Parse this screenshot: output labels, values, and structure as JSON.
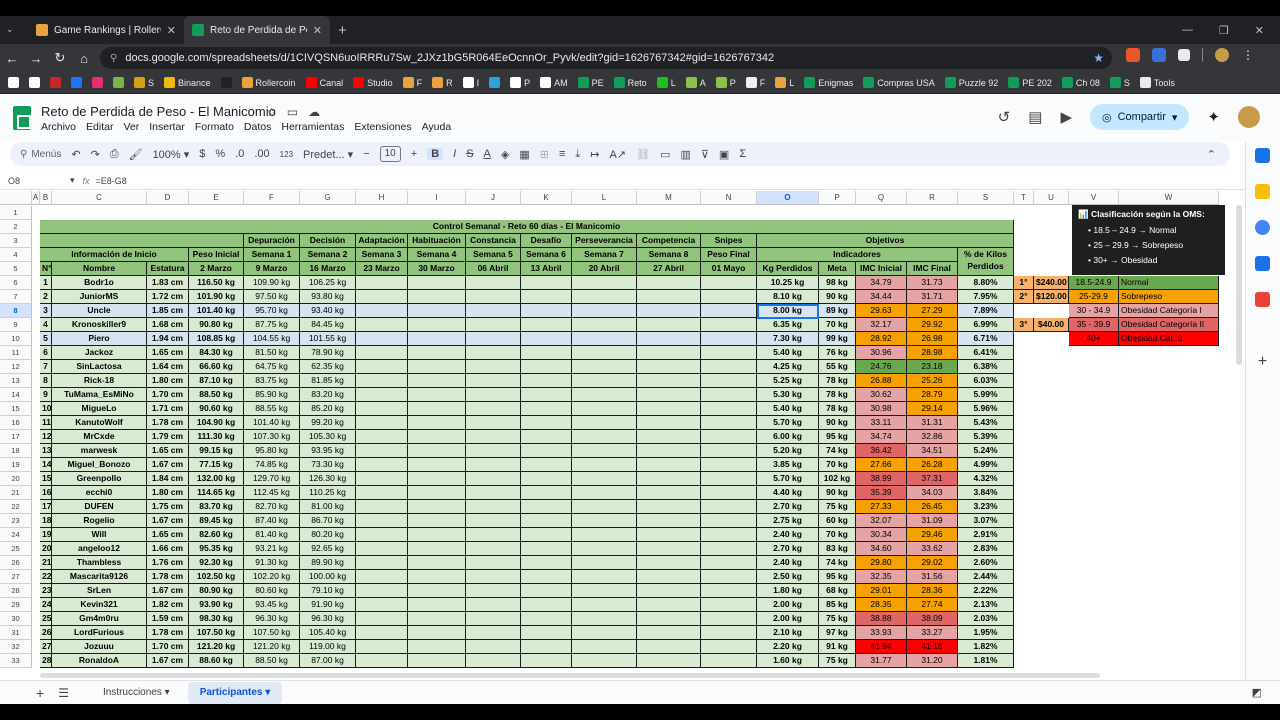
{
  "browser": {
    "tabs": [
      {
        "title": "Game Rankings | RollerCoin.com",
        "close": "✕",
        "favicon_color": "#e8a33d"
      },
      {
        "title": "Reto de Perdida de Peso - El Manicomio",
        "close": "✕",
        "favicon_color": "#0f9d58"
      }
    ],
    "new_tab": "+",
    "url": "docs.google.com/spreadsheets/d/1CIVQSN6uoIRRRu7Sw_2JXz1bG5R064EeOcnnOr_Pyvk/edit?gid=1626767342#gid=1626767342",
    "bookmarks": [
      "",
      "",
      "",
      "",
      "",
      "",
      "S",
      "Binance",
      "",
      "Rollercoin",
      "Canal",
      "Studio",
      "F",
      "R",
      "I",
      "",
      "P",
      "AM",
      "PE",
      "Reto",
      "L",
      "A",
      "P",
      "F",
      "L",
      "Enigmas",
      "Compras USA",
      "Puzzle 92",
      "PE 202",
      "Ch 08",
      "S",
      "Tools"
    ],
    "bookmark_colors": [
      "#ffffff",
      "#ffffff",
      "#c62828",
      "#1877f2",
      "#e1306c",
      "#7cb342",
      "#d4a017",
      "#f0b90b",
      "#222",
      "#e8a33d",
      "#ff0000",
      "#ff0000",
      "#e8a33d",
      "#e8a33d",
      "#ffffff",
      "#2aa3e0",
      "#ffffff",
      "#ffffff",
      "#0f9d58",
      "#0f9d58",
      "#1dbf1d",
      "#8bc34a",
      "#8bc34a",
      "#eeeeee",
      "#e8a33d",
      "#0f9d58",
      "#0f9d58",
      "#0f9d58",
      "#0f9d58",
      "#0f9d58",
      "#0f9d58",
      "#e8eaed"
    ]
  },
  "doc": {
    "title": "Reto de Perdida de Peso - El Manicomio",
    "menus": [
      "Archivo",
      "Editar",
      "Ver",
      "Insertar",
      "Formato",
      "Datos",
      "Herramientas",
      "Extensiones",
      "Ayuda"
    ],
    "share_label": "Compartir"
  },
  "toolbar": {
    "search_label": "Menús",
    "zoom": "100%",
    "currency": "$",
    "percent": "%",
    "dec_decrease": ".0",
    "dec_increase": ".00",
    "number_format": "123",
    "font": "Predet...",
    "font_size": "10",
    "minus": "−",
    "plus": "+"
  },
  "formula_bar": {
    "cell_ref": "O8",
    "fx": "fx",
    "formula": "=E8-G8"
  },
  "columns": [
    "A",
    "B",
    "C",
    "D",
    "E",
    "F",
    "G",
    "H",
    "I",
    "J",
    "K",
    "L",
    "M",
    "N",
    "O",
    "P",
    "Q",
    "R",
    "S",
    "T",
    "U",
    "V",
    "W"
  ],
  "selected_column": "O",
  "selected_row": "8",
  "sheet": {
    "banner": "Control Semanal - Reto 60 días - El Manicomio",
    "group_info": "Información de Inicio",
    "group_objetivos": "Objetivos",
    "group_indicadores": "Indicadores",
    "pct_header": "% de Kilos Perdidos",
    "week_titles": [
      "Peso Inicial",
      "Depuración",
      "Decisión",
      "Adaptación",
      "Habituación",
      "Constancia",
      "Desafío",
      "Perseverancia",
      "Competencia",
      "Snipes"
    ],
    "week_labels": [
      "Semana 1",
      "Semana 2",
      "Semana 3",
      "Semana 4",
      "Semana 5",
      "Semana 6",
      "Semana 7",
      "Semana 8",
      "Peso Final"
    ],
    "subheaders": [
      "N°",
      "Nombre",
      "Estatura",
      "2 Marzo",
      "9 Marzo",
      "16 Marzo",
      "23 Marzo",
      "30 Marzo",
      "06 Abril",
      "13 Abril",
      "20 Abril",
      "27 Abril",
      "01 Mayo",
      "Kg Perdidos",
      "Meta",
      "IMC Inicial",
      "IMC Final"
    ],
    "rows": [
      [
        "1",
        "Bodr1o",
        "1.83 cm",
        "116.50 kg",
        "109.90 kg",
        "106.25 kg",
        "10.25 kg",
        "98 kg",
        "34.79",
        "31.73",
        "8.80%"
      ],
      [
        "2",
        "JuniorMS",
        "1.72 cm",
        "101.90 kg",
        "97.50 kg",
        "93.80 kg",
        "8.10 kg",
        "90 kg",
        "34.44",
        "31.71",
        "7.95%"
      ],
      [
        "3",
        "Uncle",
        "1.85 cm",
        "101.40 kg",
        "95.70 kg",
        "93.40 kg",
        "8.00 kg",
        "89 kg",
        "29.63",
        "27.29",
        "7.89%"
      ],
      [
        "4",
        "Kronoskiller9",
        "1.68 cm",
        "90.80 kg",
        "87.75 kg",
        "84.45 kg",
        "6.35 kg",
        "70 kg",
        "32.17",
        "29.92",
        "6.99%"
      ],
      [
        "5",
        "Piero",
        "1.94 cm",
        "108.85 kg",
        "104.55 kg",
        "101.55 kg",
        "7.30 kg",
        "99 kg",
        "28.92",
        "26.98",
        "6.71%"
      ],
      [
        "6",
        "Jackoz",
        "1.65 cm",
        "84.30 kg",
        "81.50 kg",
        "78.90 kg",
        "5.40 kg",
        "76 kg",
        "30.96",
        "28.98",
        "6.41%"
      ],
      [
        "7",
        "SinLactosa",
        "1.64 cm",
        "66.60 kg",
        "64.75 kg",
        "62.35 kg",
        "4.25 kg",
        "55 kg",
        "24.76",
        "23.18",
        "6.38%"
      ],
      [
        "8",
        "Rick-18",
        "1.80 cm",
        "87.10 kg",
        "83.75 kg",
        "81.85 kg",
        "5.25 kg",
        "78 kg",
        "26.88",
        "25.26",
        "6.03%"
      ],
      [
        "9",
        "TuMama_EsMiNo",
        "1.70 cm",
        "88.50 kg",
        "85.90 kg",
        "83.20 kg",
        "5.30 kg",
        "78 kg",
        "30.62",
        "28.79",
        "5.99%"
      ],
      [
        "10",
        "MigueLo",
        "1.71 cm",
        "90.60 kg",
        "88.55 kg",
        "85.20 kg",
        "5.40 kg",
        "78 kg",
        "30.98",
        "29.14",
        "5.96%"
      ],
      [
        "11",
        "KanutoWolf",
        "1.78 cm",
        "104.90 kg",
        "101.40 kg",
        "99.20 kg",
        "5.70 kg",
        "90 kg",
        "33.11",
        "31.31",
        "5.43%"
      ],
      [
        "12",
        "MrCxde",
        "1.79 cm",
        "111.30 kg",
        "107.30 kg",
        "105.30 kg",
        "6.00 kg",
        "95 kg",
        "34.74",
        "32.86",
        "5.39%"
      ],
      [
        "13",
        "marwesk",
        "1.65 cm",
        "99.15 kg",
        "95.80 kg",
        "93.95 kg",
        "5.20 kg",
        "74 kg",
        "36.42",
        "34.51",
        "5.24%"
      ],
      [
        "14",
        "Miguel_Bonozo",
        "1.67 cm",
        "77.15 kg",
        "74.85 kg",
        "73.30 kg",
        "3.85 kg",
        "70 kg",
        "27.66",
        "26.28",
        "4.99%"
      ],
      [
        "15",
        "Greenpollo",
        "1.84 cm",
        "132.00 kg",
        "129.70 kg",
        "126.30 kg",
        "5.70 kg",
        "102 kg",
        "38.99",
        "37.31",
        "4.32%"
      ],
      [
        "16",
        "ecchi0",
        "1.80 cm",
        "114.65 kg",
        "112.45 kg",
        "110.25 kg",
        "4.40 kg",
        "90 kg",
        "35.39",
        "34.03",
        "3.84%"
      ],
      [
        "17",
        "DUFEN",
        "1.75 cm",
        "83.70 kg",
        "82.70 kg",
        "81.00 kg",
        "2.70 kg",
        "75 kg",
        "27.33",
        "26.45",
        "3.23%"
      ],
      [
        "18",
        "Rogelio",
        "1.67 cm",
        "89.45 kg",
        "87.40 kg",
        "86.70 kg",
        "2.75 kg",
        "60 kg",
        "32.07",
        "31.09",
        "3.07%"
      ],
      [
        "19",
        "Will",
        "1.65 cm",
        "82.60 kg",
        "81.40 kg",
        "80.20 kg",
        "2.40 kg",
        "70 kg",
        "30.34",
        "29.46",
        "2.91%"
      ],
      [
        "20",
        "angeloo12",
        "1.66 cm",
        "95.35 kg",
        "93.21 kg",
        "92.65 kg",
        "2.70 kg",
        "83 kg",
        "34.60",
        "33.62",
        "2.83%"
      ],
      [
        "21",
        "Thambless",
        "1.76 cm",
        "92.30 kg",
        "91.30 kg",
        "89.90 kg",
        "2.40 kg",
        "74 kg",
        "29.80",
        "29.02",
        "2.60%"
      ],
      [
        "22",
        "Mascarita9126",
        "1.78 cm",
        "102.50 kg",
        "102.20 kg",
        "100.00 kg",
        "2.50 kg",
        "95 kg",
        "32.35",
        "31.56",
        "2.44%"
      ],
      [
        "23",
        "SrLen",
        "1.67 cm",
        "80.90 kg",
        "80.60 kg",
        "79.10 kg",
        "1.80 kg",
        "68 kg",
        "29.01",
        "28.36",
        "2.22%"
      ],
      [
        "24",
        "Kevin321",
        "1.82 cm",
        "93.90 kg",
        "93.45 kg",
        "91.90 kg",
        "2.00 kg",
        "85 kg",
        "28.35",
        "27.74",
        "2.13%"
      ],
      [
        "25",
        "Gm4m0ru",
        "1.59 cm",
        "98.30 kg",
        "96.30 kg",
        "96.30 kg",
        "2.00 kg",
        "75 kg",
        "38.88",
        "38.09",
        "2.03%"
      ],
      [
        "26",
        "LordFurious",
        "1.78 cm",
        "107.50 kg",
        "107.50 kg",
        "105.40 kg",
        "2.10 kg",
        "97 kg",
        "33.93",
        "33.27",
        "1.95%"
      ],
      [
        "27",
        "Jozuuu",
        "1.70 cm",
        "121.20 kg",
        "121.20 kg",
        "119.00 kg",
        "2.20 kg",
        "91 kg",
        "41.94",
        "41.18",
        "1.82%"
      ],
      [
        "28",
        "RonaldoA",
        "1.67 cm",
        "88.60 kg",
        "88.50 kg",
        "87.00 kg",
        "1.60 kg",
        "75 kg",
        "31.77",
        "31.20",
        "1.81%"
      ]
    ],
    "prizes": [
      {
        "place": "1°",
        "amount": "$240.00"
      },
      {
        "place": "2°",
        "amount": "$120.00"
      },
      {
        "place": "3°",
        "amount": "$40.00"
      }
    ],
    "bmi_categories": [
      {
        "range": "18.5-24.9",
        "label": "Normal",
        "color": "#6aa84f"
      },
      {
        "range": "25-29.9",
        "label": "Sobrepeso",
        "color": "#f6a100"
      },
      {
        "range": "30 - 34.9",
        "label": "Obesidad Categoría I",
        "color": "#e6a3a3"
      },
      {
        "range": "35 - 39.9",
        "label": "Obesidad Categoría II",
        "color": "#e06666"
      },
      {
        "range": "40+",
        "label": "Obesidad Cat. 3",
        "color": "#ff0000"
      }
    ]
  },
  "legend": {
    "title": "📊 Clasificación según la OMS:",
    "items": [
      "• 18.5 – 24.9 → Normal",
      "• 25 – 29.9 → Sobrepeso",
      "• 30+ → Obesidad"
    ]
  },
  "sheet_tabs": [
    "Instrucciones",
    "Participantes"
  ],
  "active_sheet": "Participantes"
}
